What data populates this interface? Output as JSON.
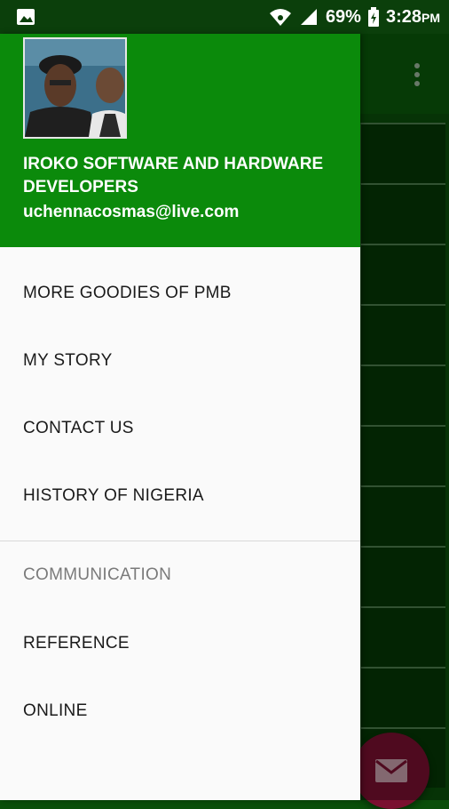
{
  "status_bar": {
    "battery_percent": "69%",
    "time": "3:28",
    "time_suffix": "PM",
    "icons": [
      "image-notification-icon",
      "wifi-icon",
      "signal-icon",
      "battery-icon"
    ]
  },
  "drawer": {
    "header": {
      "title": "IROKO SOFTWARE AND HARDWARE DEVELOPERS",
      "email": "uchennacosmas@live.com",
      "accent_color": "#0b8a0b"
    },
    "items": [
      {
        "label": "MORE GOODIES OF PMB"
      },
      {
        "label": "MY STORY"
      },
      {
        "label": "CONTACT US"
      },
      {
        "label": "HISTORY OF NIGERIA"
      }
    ],
    "section": {
      "header": "COMMUNICATION",
      "items": [
        {
          "label": "REFERENCE"
        },
        {
          "label": "ONLINE"
        }
      ]
    }
  },
  "background": {
    "fab_icon": "mail-icon",
    "fab_color": "#7a1030",
    "app_bar_color": "#0a5a0a"
  }
}
